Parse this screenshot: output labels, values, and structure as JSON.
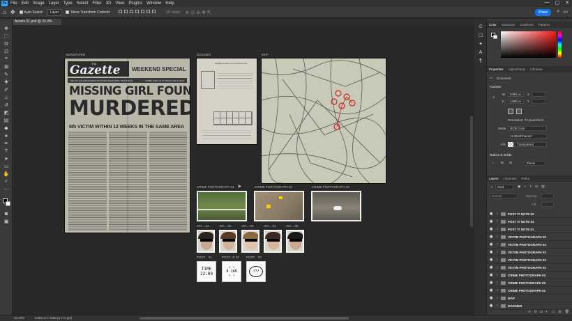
{
  "menu": {
    "logo": "Ps",
    "items": [
      "File",
      "Edit",
      "Image",
      "Layer",
      "Type",
      "Select",
      "Filter",
      "3D",
      "View",
      "Plugins",
      "Window",
      "Help"
    ],
    "controls": [
      "—",
      "▢",
      "✕"
    ]
  },
  "options": {
    "auto_select_label": "Auto-Select:",
    "auto_select_value": "Layer",
    "transform_label": "Show Transform Controls",
    "mode_3d": "3D Mode:",
    "share_label": "Share"
  },
  "document": {
    "tab_title": "Assets 01.psd @ 33.3% (RGB/16#)",
    "tab_close": "×"
  },
  "canvas": {
    "labels": {
      "newspaper": "NEWSPAPER",
      "dossier": "DOSSIER",
      "map": "MAP",
      "crime1": "CRIME PHOTOGRAPH 01",
      "crime2": "CRIME PHOTOGRAPH 02",
      "crime3": "CRIME PHOTOGRAPH 03",
      "vic1": "VIC... 01",
      "vic2": "VIC... 02",
      "vic3": "VIC... 03",
      "vic4": "VIC... 04",
      "vic5": "VIC... 05",
      "post1": "POST... 01",
      "post2": "POST...E 02",
      "post3": "POST... 03"
    },
    "newspaper": {
      "masthead_the": "The",
      "masthead_name": "Gazette",
      "weekend": "WEEKEND SPECIAL",
      "tagline_left": "THE POLICE DISCOVERED ANOTHER DEAD BODY YESTERDAY",
      "tagline_right": "\"CRIME SIMILAR TO UNSOLVED CASES\"",
      "headline1": "MISSING GIRL FOUND",
      "headline2": "MURDERED",
      "subhead": "6th VICTIM WITHIN 12 WEEKS IN THE SAME AREA"
    },
    "dossier": {
      "title": "FEDERAL BUREAU OF INVESTIGATION"
    },
    "postits": {
      "p1_line1": "TIME",
      "p1_line2": "22:09",
      "p2_line1": "8 JAN",
      "p3": "???"
    }
  },
  "statusbar": {
    "zoom": "33.33%",
    "info": "6466 px x 4488 px (72 ppi)"
  },
  "panels": {
    "color_tabs": [
      "Color",
      "Swatches",
      "Gradients",
      "Patterns"
    ],
    "props_tabs": [
      "Properties",
      "Adjustments",
      "Libraries"
    ],
    "doc_label": "Document",
    "canvas_section": "Canvas",
    "w_label": "W",
    "w_value": "6456 px",
    "h_label": "H",
    "h_value": "4488 px",
    "x_label": "X",
    "y_label": "Y",
    "resolution": "Resolution: 72 pixels/inch",
    "mode_label": "Mode",
    "mode_value": "RGB Color",
    "depth_value": "16 Bits/Channel",
    "fill_label": "Fill",
    "fill_value": "Transparent",
    "rulers_section": "Rulers & Grids",
    "units_value": "Pixels",
    "layers_tabs": [
      "Layers",
      "Channels",
      "Paths"
    ],
    "kind_label": "Kind",
    "blend_value": "Normal",
    "opacity_label": "Opacity:",
    "fill2_label": "Fill:",
    "layers": [
      "POST IT NOTE 02",
      "POST IT NOTE 03",
      "POST IT NOTE 01",
      "VICTIM PHOTOGRAPH 05",
      "VICTIM PHOTOGRAPH 04",
      "VICTIM PHOTOGRAPH 03",
      "VICTIM PHOTOGRAPH 02",
      "VICTIM PHOTOGRAPH 01",
      "CRIME PHOTOGRAPH 03",
      "CRIME PHOTOGRAPH 02",
      "CRIME PHOTOGRAPH 01",
      "MAP",
      "DOSSIER"
    ]
  },
  "colors": {
    "accent": "#1473e6",
    "panel": "#3a3a3a",
    "canvas": "#282828"
  }
}
